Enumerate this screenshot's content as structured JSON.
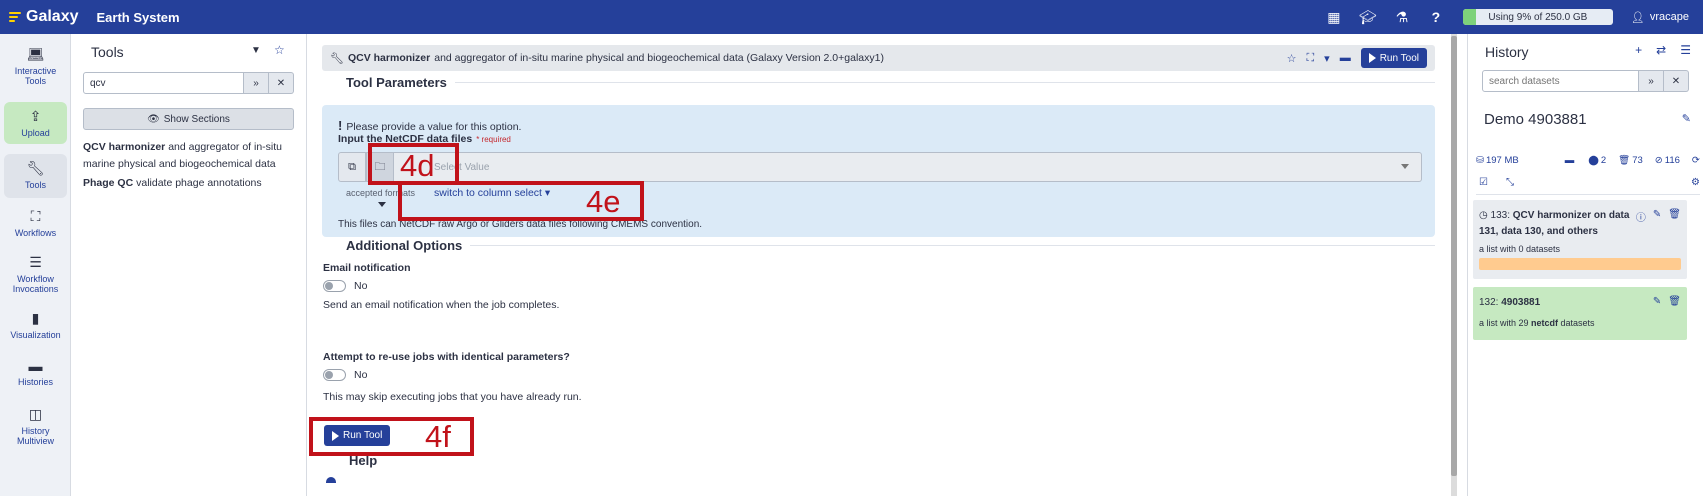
{
  "topbar": {
    "brand": "Galaxy",
    "site_name": "Earth System",
    "quota_text": "Using 9% of 250.0 GB",
    "quota_percent": 9,
    "user": "vracape",
    "icons": [
      "grid-icon",
      "graduation-cap-icon",
      "flask-icon",
      "help-icon"
    ]
  },
  "activity": {
    "interactive_tools": "Interactive Tools",
    "upload": "Upload",
    "tools": "Tools",
    "workflows": "Workflows",
    "workflow_invocations": "Workflow Invocations",
    "visualization": "Visualization",
    "histories": "Histories",
    "history_multiview": "History Multiview"
  },
  "toolpanel": {
    "title": "Tools",
    "search_value": "qcv",
    "show_sections": "Show Sections",
    "results": [
      {
        "name": "QCV harmonizer",
        "desc": " and aggregator of in-situ marine physical and biogeochemical data"
      },
      {
        "name": "Phage QC",
        "desc": " validate phage annotations"
      }
    ]
  },
  "tool": {
    "name": "QCV harmonizer",
    "title_rest": "and aggregator of in-situ marine physical and biogeochemical data (Galaxy Version 2.0+galaxy1)",
    "run_label": "Run Tool",
    "params_title": "Tool Parameters",
    "warning": "Please provide a value for this option.",
    "input_label": "Input the NetCDF data files",
    "required": "* required",
    "select_placeholder": "Select Value",
    "accepted_formats": "accepted formats",
    "switch_link": "switch to column select",
    "input_help": "This files can NetCDF raw Argo or Gliders data files following CMEMS convention.",
    "additional_title": "Additional Options",
    "email_label": "Email notification",
    "email_value": "No",
    "email_help": "Send an email notification when the job completes.",
    "reuse_label": "Attempt to re-use jobs with identical parameters?",
    "reuse_value": "No",
    "reuse_help": "This may skip executing jobs that you have already run.",
    "help_title": "Help"
  },
  "annotations": {
    "a": "4d",
    "b": "4e",
    "c": "4f"
  },
  "history": {
    "title": "History",
    "search_placeholder": "search datasets",
    "name": "Demo 4903881",
    "size": "197 MB",
    "count_shown": "2",
    "count_deleted": "73",
    "count_hidden": "116",
    "items": [
      {
        "hid": "133:",
        "title": "QCV harmonizer on data 131, data 130, and others",
        "sub": "a list with 0 datasets"
      },
      {
        "hid": "132:",
        "title": "4903881",
        "sub_pre": "a list with 29 ",
        "sub_bold": "netcdf",
        "sub_post": " datasets"
      }
    ]
  },
  "colors": {
    "brand": "#25409a",
    "annotation": "#c1121a",
    "ok": "#c6e9c1",
    "queued": "#ffcb8f"
  }
}
